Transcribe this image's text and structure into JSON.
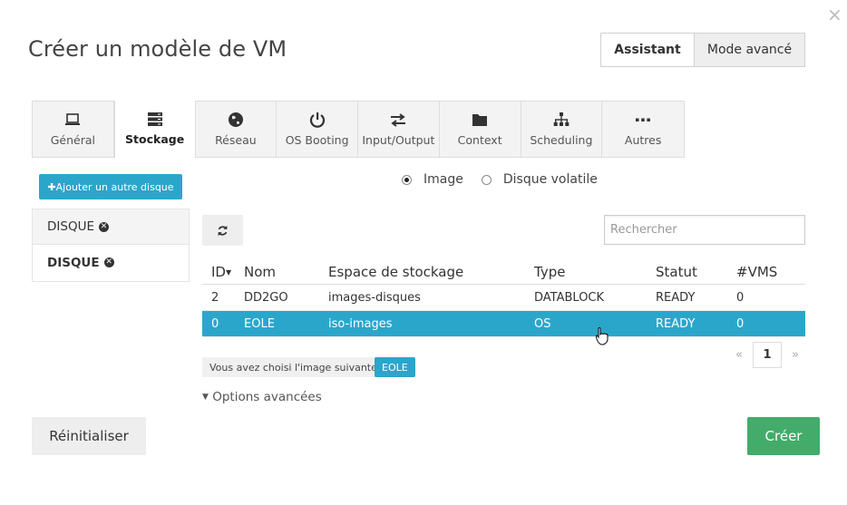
{
  "dialog": {
    "title": "Créer un modèle de VM",
    "close_label": "×"
  },
  "modes": {
    "wizard": "Assistant",
    "advanced": "Mode avancé"
  },
  "tabs": [
    {
      "label": "Général",
      "icon": "laptop-icon"
    },
    {
      "label": "Stockage",
      "icon": "storage-icon",
      "active": true
    },
    {
      "label": "Réseau",
      "icon": "globe-icon"
    },
    {
      "label": "OS Booting",
      "icon": "power-icon"
    },
    {
      "label": "Input/Output",
      "icon": "exchange-icon"
    },
    {
      "label": "Context",
      "icon": "folder-icon"
    },
    {
      "label": "Scheduling",
      "icon": "sitemap-icon"
    },
    {
      "label": "Autres",
      "icon": "ellipsis-icon"
    }
  ],
  "storage": {
    "add_disk_label": "✚Ajouter un autre disque",
    "disks": [
      {
        "label": "DISQUE",
        "remove": "✕"
      },
      {
        "label": "DISQUE",
        "remove": "✕",
        "active": true
      }
    ],
    "source_options": [
      {
        "label": "Image",
        "checked": true
      },
      {
        "label": "Disque volatile",
        "checked": false
      }
    ],
    "search_placeholder": "Rechercher",
    "columns": [
      "ID",
      "Nom",
      "Espace de stockage",
      "Type",
      "Statut",
      "#VMS"
    ],
    "rows": [
      {
        "id": "2",
        "name": "DD2GO",
        "datastore": "images-disques",
        "type": "DATABLOCK",
        "status": "READY",
        "vms": "0",
        "selected": false
      },
      {
        "id": "0",
        "name": "EOLE",
        "datastore": "iso-images",
        "type": "OS",
        "status": "READY",
        "vms": "0",
        "selected": true
      }
    ],
    "pagination": {
      "prev": "«",
      "current": "1",
      "next": "»"
    },
    "chosen_label": "Vous avez choisi l'image suivante:",
    "chosen_value": "EOLE",
    "advanced_options": "Options avancées"
  },
  "footer": {
    "reset_label": "Réinitialiser",
    "create_label": "Créer"
  },
  "colors": {
    "accent": "#2ba6cb",
    "success": "#43ac6a"
  }
}
